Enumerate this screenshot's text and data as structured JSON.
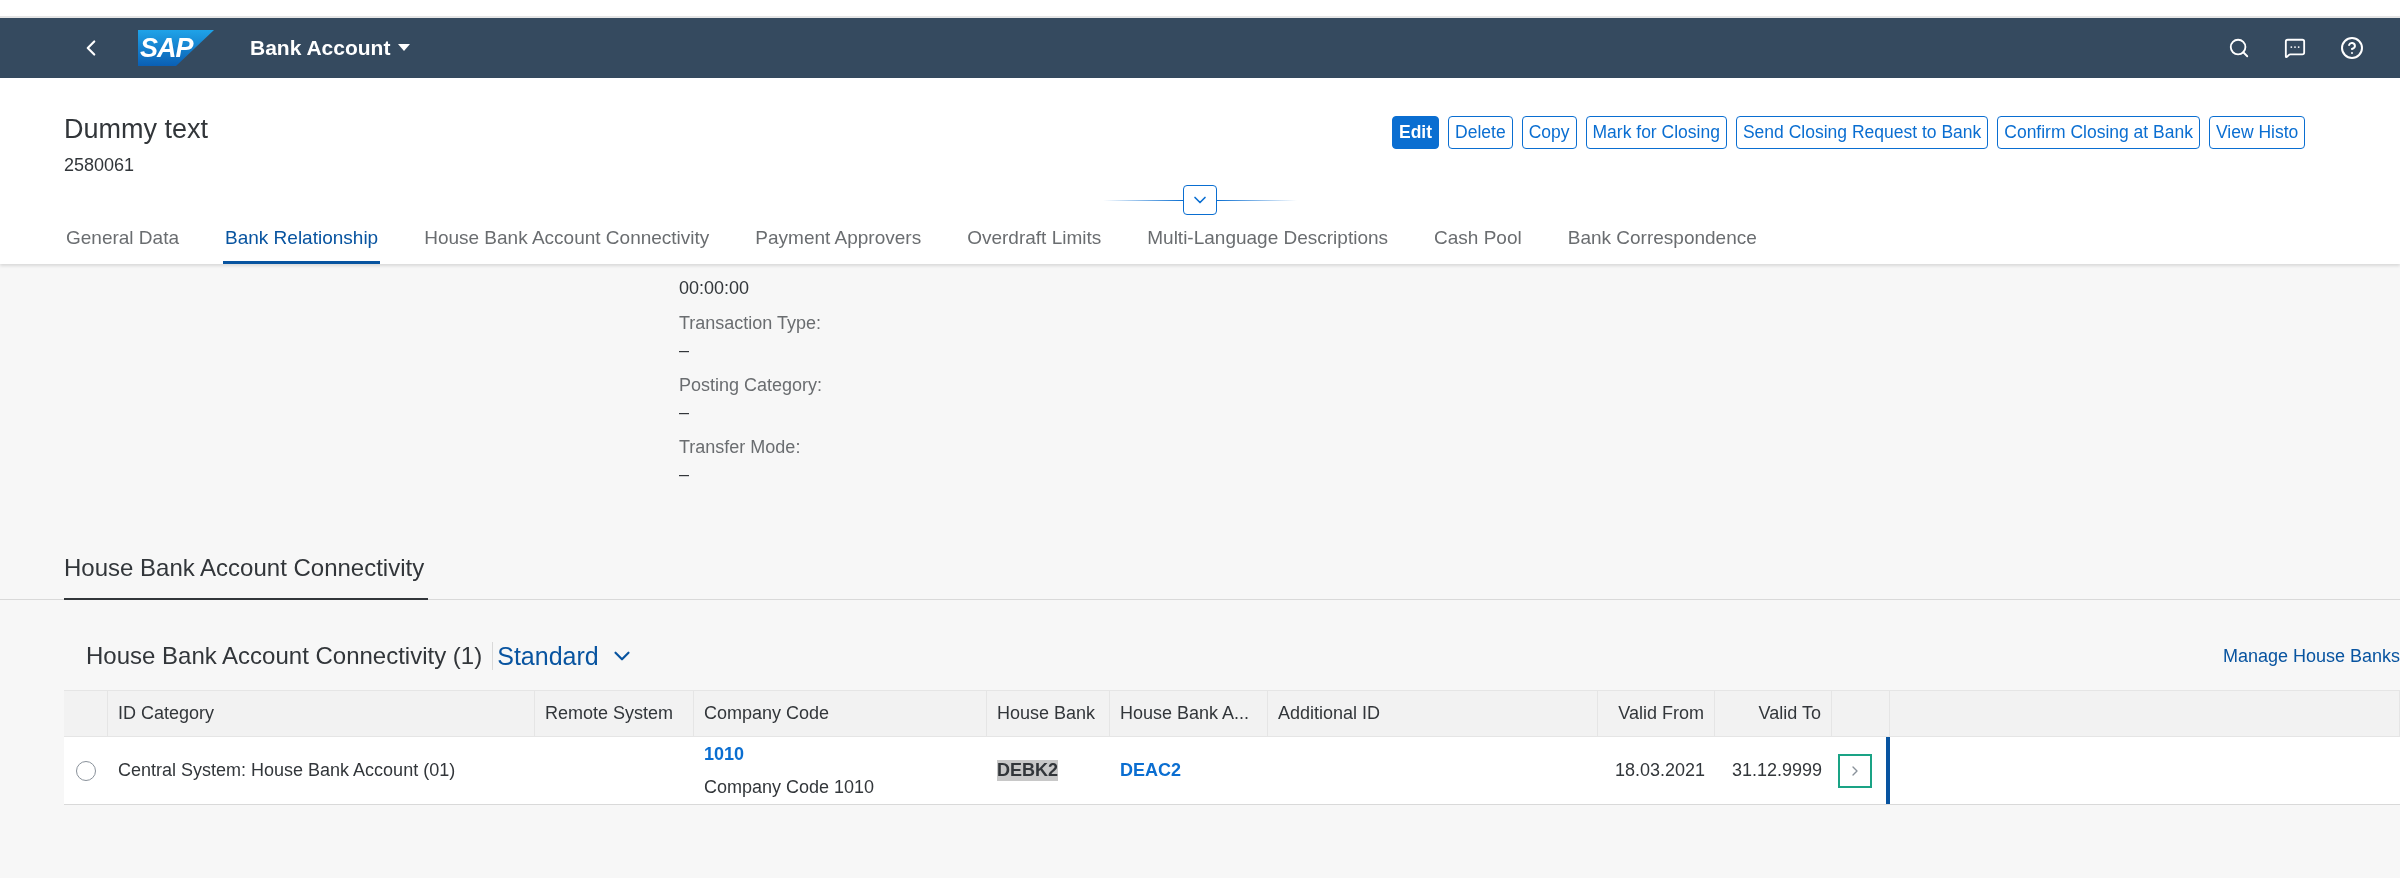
{
  "shell": {
    "logo": "SAP",
    "title": "Bank Account"
  },
  "header": {
    "title": "Dummy text",
    "subtitle": "2580061"
  },
  "actions": [
    {
      "label": "Edit",
      "kind": "emphasized"
    },
    {
      "label": "Delete",
      "kind": "default"
    },
    {
      "label": "Copy",
      "kind": "default"
    },
    {
      "label": "Mark for Closing",
      "kind": "default"
    },
    {
      "label": "Send Closing Request to Bank",
      "kind": "default"
    },
    {
      "label": "Confirm Closing at Bank",
      "kind": "default"
    },
    {
      "label": "View Histo",
      "kind": "default"
    }
  ],
  "tabs": [
    {
      "label": "General Data",
      "selected": false
    },
    {
      "label": "Bank Relationship",
      "selected": true
    },
    {
      "label": "House Bank Account Connectivity",
      "selected": false
    },
    {
      "label": "Payment Approvers",
      "selected": false
    },
    {
      "label": "Overdraft Limits",
      "selected": false
    },
    {
      "label": "Multi-Language Descriptions",
      "selected": false
    },
    {
      "label": "Cash Pool",
      "selected": false
    },
    {
      "label": "Bank Correspondence",
      "selected": false
    }
  ],
  "fields": [
    {
      "value": "00:00:00"
    },
    {
      "label": "Transaction Type:",
      "value": "–"
    },
    {
      "label": "Posting Category:",
      "value": "–"
    },
    {
      "label": "Transfer Mode:",
      "value": "–"
    }
  ],
  "section": {
    "title": "House Bank Account Connectivity"
  },
  "table": {
    "title": "House Bank Account Connectivity (1)",
    "variant": "Standard",
    "action": "Manage House Banks",
    "columns": [
      {
        "label": "ID Category",
        "numeric": false
      },
      {
        "label": "Remote System",
        "numeric": false
      },
      {
        "label": "Company Code",
        "numeric": false
      },
      {
        "label": "House Bank",
        "numeric": false
      },
      {
        "label": "House Bank A...",
        "numeric": false
      },
      {
        "label": "Additional ID",
        "numeric": false
      },
      {
        "label": "Valid From",
        "numeric": true
      },
      {
        "label": "Valid To",
        "numeric": true
      }
    ],
    "rows": [
      {
        "selected": false,
        "navigated": true,
        "focused": true,
        "cells": [
          {
            "kind": "text",
            "text": "Central System: House Bank Account (01)"
          },
          null,
          {
            "kind": "link-with-text",
            "link": "1010",
            "text": "Company Code 1010"
          },
          {
            "kind": "highlight",
            "text": "DEBK2"
          },
          {
            "kind": "link",
            "text": "DEAC2"
          },
          null,
          {
            "kind": "text",
            "text": "18.03.2021"
          },
          {
            "kind": "text",
            "text": "31.12.9999"
          }
        ]
      }
    ]
  }
}
